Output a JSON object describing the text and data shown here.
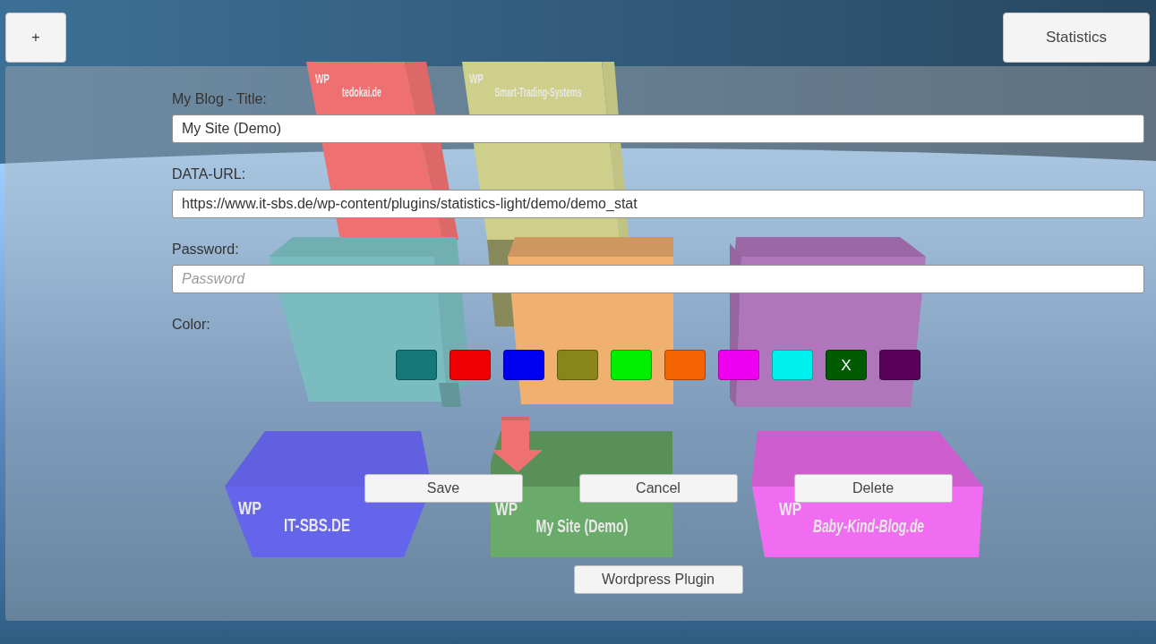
{
  "toolbar": {
    "add_button": "+",
    "statistics_button": "Statistics"
  },
  "scene": {
    "blocks": [
      {
        "badge": "WP",
        "label": "tedokai.de",
        "color": "#ee7070",
        "selected": false
      },
      {
        "badge": "WP",
        "label": "Smart-Trading-Systems",
        "color": "#cdcf8a",
        "selected": false
      },
      {
        "color": "#7bbcc0",
        "selected": false
      },
      {
        "color": "#efb070",
        "selected": false
      },
      {
        "color": "#b076bb",
        "selected": false
      },
      {
        "badge": "WP",
        "label": "IT-SBS.DE",
        "color": "#6565ec",
        "selected": false
      },
      {
        "badge": "WP",
        "label": "My Site (Demo)",
        "color": "#6aaa6a",
        "selected": true
      },
      {
        "badge": "WP",
        "label": "Baby-Kind-Blog.de",
        "color": "#f06cf0",
        "selected": false
      }
    ]
  },
  "form": {
    "fields": [
      {
        "label": "My Blog - Title:",
        "value": "My Site (Demo)"
      },
      {
        "label": "DATA-URL:",
        "value": "https://www.it-sbs.de/wp-content/plugins/statistics-light/demo/demo_stat"
      },
      {
        "label": "Password:",
        "placeholder": "Password"
      }
    ],
    "color_picker": {
      "label": "Color:",
      "selected_mark": "X",
      "swatches": [
        {
          "color": "#167878",
          "selected": false
        },
        {
          "color": "#f00000",
          "selected": false
        },
        {
          "color": "#0000f0",
          "selected": false
        },
        {
          "color": "#86861a",
          "selected": false
        },
        {
          "color": "#00f000",
          "selected": false
        },
        {
          "color": "#f46400",
          "selected": false
        },
        {
          "color": "#f000f0",
          "selected": false
        },
        {
          "color": "#00f0f0",
          "selected": false
        },
        {
          "color": "#005a00",
          "selected": true
        },
        {
          "color": "#5a005a",
          "selected": false
        }
      ]
    },
    "buttons": [
      "Save",
      "Cancel",
      "Delete"
    ],
    "plugin_button": "Wordpress Plugin"
  }
}
